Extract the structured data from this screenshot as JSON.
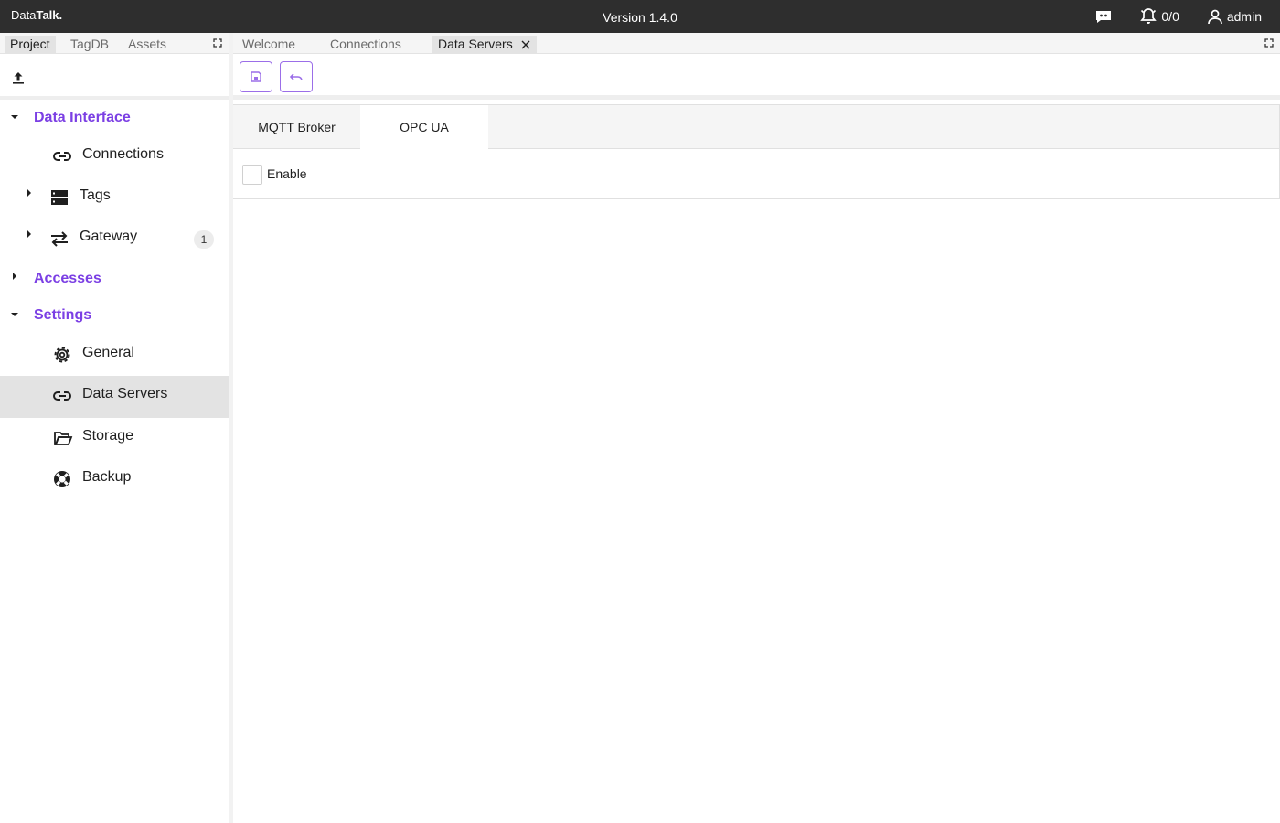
{
  "app": {
    "logo_regular": "Data",
    "logo_bold": "Talk.",
    "version": "Version 1.4.0",
    "alarm_count": "0/0",
    "user": "admin"
  },
  "left_tabs": [
    "Project",
    "TagDB",
    "Assets"
  ],
  "tree": {
    "data_interface": "Data Interface",
    "connections": "Connections",
    "tags": "Tags",
    "gateway": "Gateway",
    "gateway_badge": "1",
    "accesses": "Accesses",
    "settings": "Settings",
    "general": "General",
    "data_servers": "Data Servers",
    "storage": "Storage",
    "backup": "Backup"
  },
  "doc_tabs": [
    "Welcome",
    "Connections",
    "Data Servers"
  ],
  "server_tabs": [
    "MQTT Broker",
    "OPC UA"
  ],
  "enable_label": "Enable",
  "colors": {
    "accent": "#7b3fe4",
    "topbar": "#2e2e2e",
    "selected": "#e3e3e3"
  }
}
